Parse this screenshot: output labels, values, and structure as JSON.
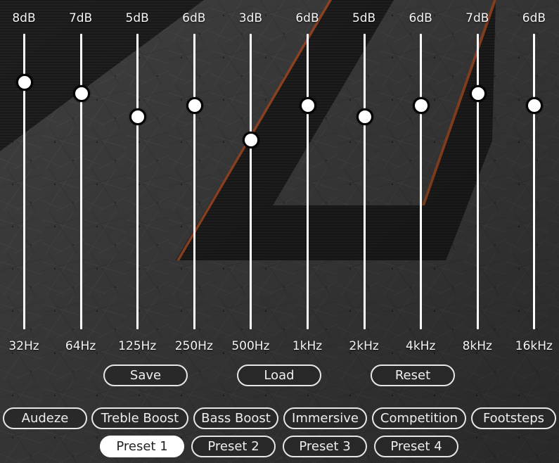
{
  "bands": [
    {
      "gain": "8dB",
      "freq": "32Hz",
      "level": 8
    },
    {
      "gain": "7dB",
      "freq": "64Hz",
      "level": 7
    },
    {
      "gain": "5dB",
      "freq": "125Hz",
      "level": 5
    },
    {
      "gain": "6dB",
      "freq": "250Hz",
      "level": 6
    },
    {
      "gain": "3dB",
      "freq": "500Hz",
      "level": 3
    },
    {
      "gain": "6dB",
      "freq": "1kHz",
      "level": 6
    },
    {
      "gain": "5dB",
      "freq": "2kHz",
      "level": 5
    },
    {
      "gain": "6dB",
      "freq": "4kHz",
      "level": 6
    },
    {
      "gain": "7dB",
      "freq": "8kHz",
      "level": 7
    },
    {
      "gain": "6dB",
      "freq": "16kHz",
      "level": 6
    }
  ],
  "actions": {
    "save": "Save",
    "load": "Load",
    "reset": "Reset"
  },
  "profiles": [
    "Audeze",
    "Treble Boost",
    "Bass Boost",
    "Immersive",
    "Competition",
    "Footsteps"
  ],
  "presets": [
    "Preset 1",
    "Preset 2",
    "Preset 3",
    "Preset 4"
  ],
  "active_preset": "Preset 1",
  "colors": {
    "accent_stripe": "#b8562a",
    "active_pill": "#ffffff"
  }
}
